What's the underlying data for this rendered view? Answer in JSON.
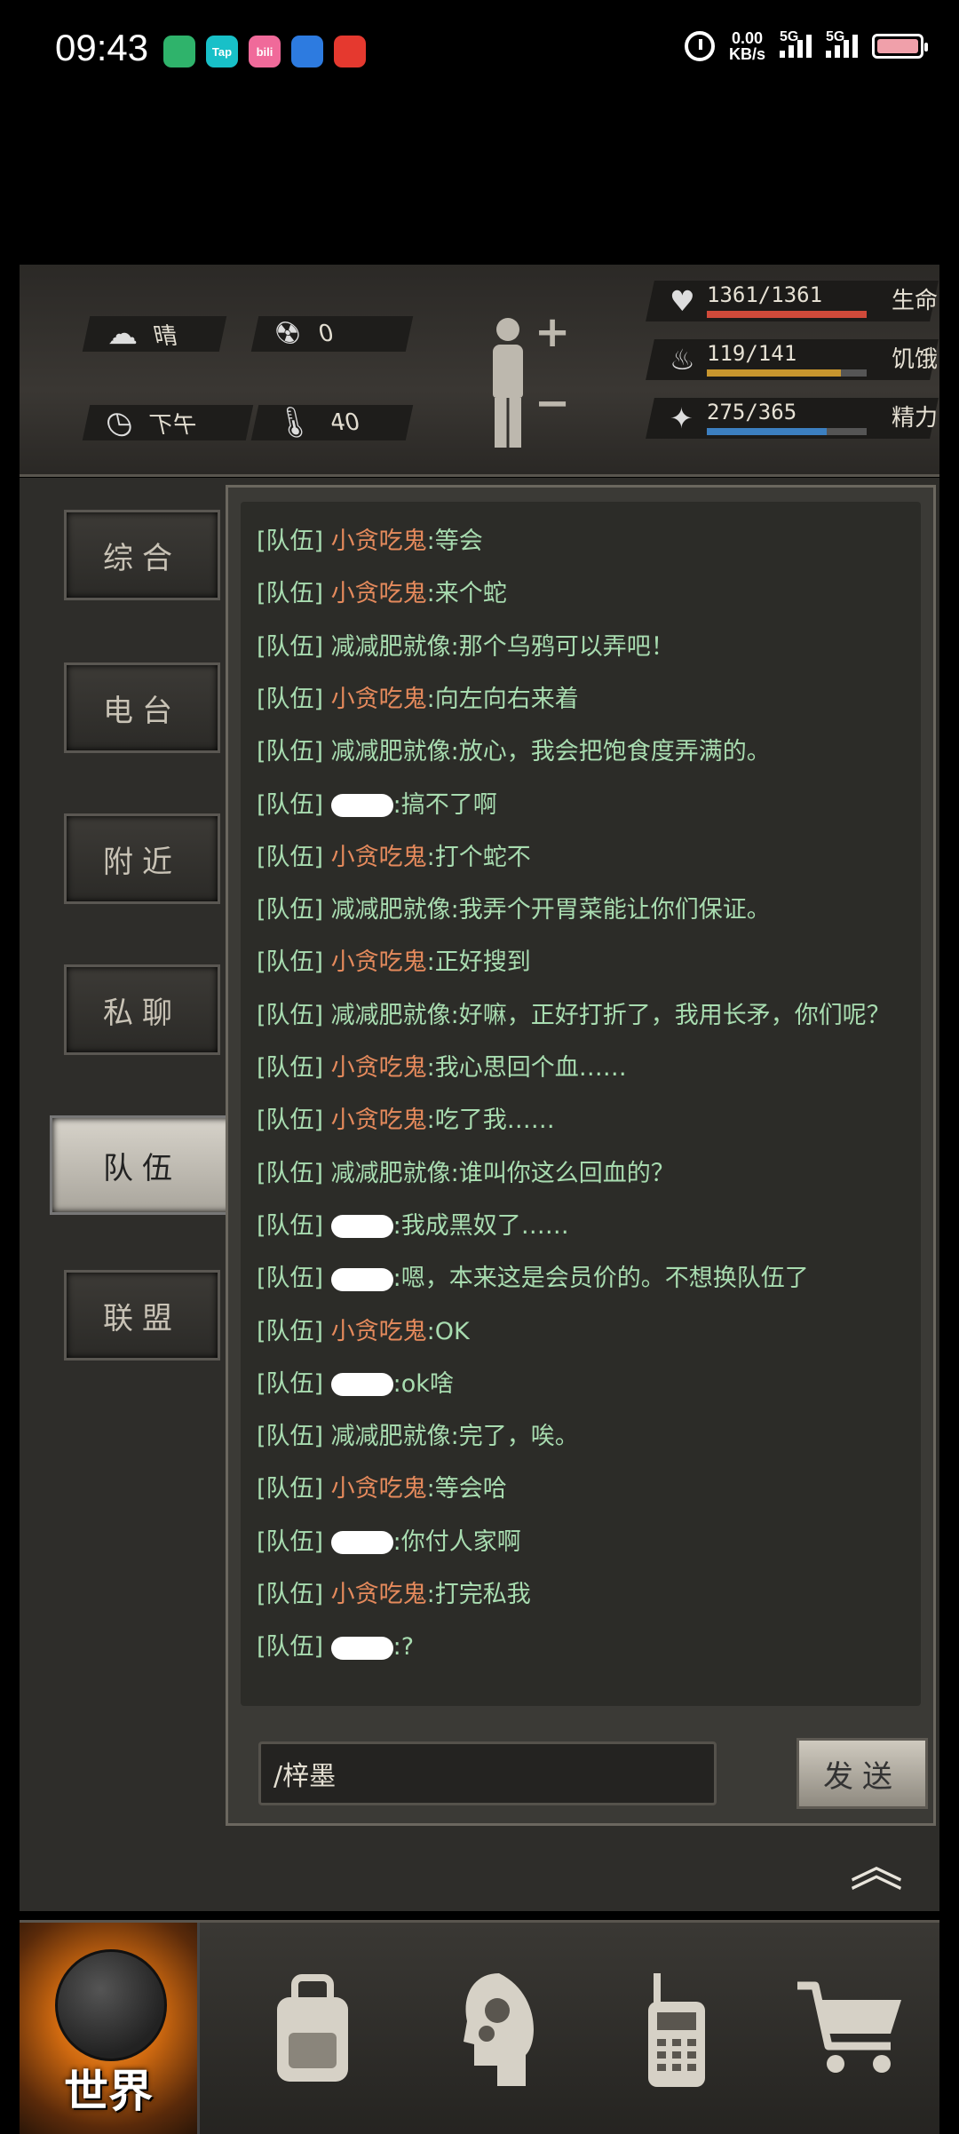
{
  "status_bar": {
    "time": "09:43",
    "app_icons": [
      {
        "label": "",
        "color": "#2fb36b"
      },
      {
        "label": "Tap",
        "color": "#18c0c8"
      },
      {
        "label": "bili",
        "color": "#f06a9a"
      },
      {
        "label": "",
        "color": "#2d7be0"
      },
      {
        "label": "",
        "color": "#e5392f"
      }
    ],
    "net_speed_value": "0.00",
    "net_speed_unit": "KB/s",
    "signal1": "5G",
    "signal2": "5G",
    "battery_color": "#f0a0aa"
  },
  "environment": {
    "weather": "晴",
    "radiation": "0",
    "time_of_day": "下午",
    "temperature": "40"
  },
  "stats": [
    {
      "label": "生命",
      "value": "1361/1361",
      "fill": 1.0,
      "color": "#d04a3a",
      "icon": "heart-icon"
    },
    {
      "label": "饥饿",
      "value": "119/141",
      "fill": 0.84,
      "color": "#c8962e",
      "icon": "stomach-icon"
    },
    {
      "label": "精力",
      "value": "275/365",
      "fill": 0.75,
      "color": "#3c7fc0",
      "icon": "energy-icon"
    }
  ],
  "tabs": [
    {
      "label": "综合",
      "active": false
    },
    {
      "label": "电台",
      "active": false
    },
    {
      "label": "附近",
      "active": false
    },
    {
      "label": "私聊",
      "active": false
    },
    {
      "label": "队伍",
      "active": true
    },
    {
      "label": "联盟",
      "active": false
    }
  ],
  "chat": {
    "channel_tag": "[队伍]",
    "messages": [
      {
        "name": "小贪吃鬼",
        "name_color": "orange",
        "text": ":等会",
        "redacted": false
      },
      {
        "name": "小贪吃鬼",
        "name_color": "orange",
        "text": ":来个蛇",
        "redacted": false
      },
      {
        "name": "减减肥就像",
        "name_color": "green",
        "text": ":那个乌鸦可以弄吧！",
        "redacted": false
      },
      {
        "name": "小贪吃鬼",
        "name_color": "orange",
        "text": ":向左向右来着",
        "redacted": false
      },
      {
        "name": "减减肥就像",
        "name_color": "green",
        "text": ":放心，我会把饱食度弄满的。",
        "redacted": false
      },
      {
        "name": "",
        "name_color": "green",
        "text": ":搞不了啊",
        "redacted": true
      },
      {
        "name": "小贪吃鬼",
        "name_color": "orange",
        "text": ":打个蛇不",
        "redacted": false
      },
      {
        "name": "减减肥就像",
        "name_color": "green",
        "text": ":我弄个开胃菜能让你们保证。",
        "redacted": false
      },
      {
        "name": "小贪吃鬼",
        "name_color": "orange",
        "text": ":正好搜到",
        "redacted": false
      },
      {
        "name": "减减肥就像",
        "name_color": "green",
        "text": ":好嘛，正好打折了，我用长矛，你们呢？",
        "redacted": false
      },
      {
        "name": "小贪吃鬼",
        "name_color": "orange",
        "text": ":我心思回个血……",
        "redacted": false
      },
      {
        "name": "小贪吃鬼",
        "name_color": "orange",
        "text": ":吃了我……",
        "redacted": false
      },
      {
        "name": "减减肥就像",
        "name_color": "green",
        "text": ":谁叫你这么回血的？",
        "redacted": false
      },
      {
        "name": "",
        "name_color": "green",
        "text": ":我成黑奴了……",
        "redacted": true
      },
      {
        "name": "",
        "name_color": "green",
        "text": ":嗯，本来这是会员价的。不想换队伍了",
        "redacted": true
      },
      {
        "name": "小贪吃鬼",
        "name_color": "orange",
        "text": ":OK",
        "redacted": false
      },
      {
        "name": "",
        "name_color": "green",
        "text": ":ok啥",
        "redacted": true
      },
      {
        "name": "减减肥就像",
        "name_color": "green",
        "text": ":完了，唉。",
        "redacted": false
      },
      {
        "name": "小贪吃鬼",
        "name_color": "orange",
        "text": ":等会哈",
        "redacted": false
      },
      {
        "name": "",
        "name_color": "green",
        "text": ":你付人家啊",
        "redacted": true
      },
      {
        "name": "小贪吃鬼",
        "name_color": "orange",
        "text": ":打完私我",
        "redacted": false
      },
      {
        "name": "",
        "name_color": "green",
        "text": ":?",
        "redacted": true
      }
    ],
    "input_value": "/梓墨",
    "send_label": "发送"
  },
  "bottom_nav": {
    "world_label": "世界",
    "items": [
      "backpack-icon",
      "skills-head-icon",
      "radio-phone-icon",
      "shop-cart-icon"
    ]
  }
}
